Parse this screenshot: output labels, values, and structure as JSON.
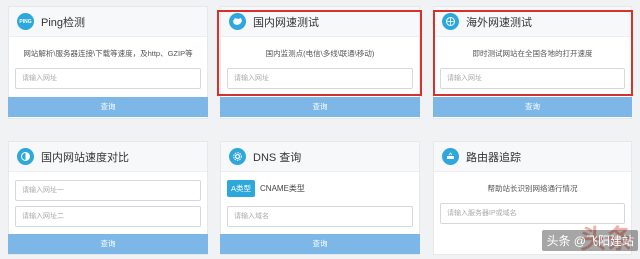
{
  "cards": [
    {
      "title": "Ping检测",
      "icon_label": "PING",
      "icon": "ping-icon",
      "description": "网站解析\\服务器连接\\下载等速度，及http、GZIP等",
      "input_placeholder": "请输入网址",
      "button": "查询"
    },
    {
      "title": "国内网速测试",
      "icon": "china-map-icon",
      "description": "国内监测点(电信\\多线\\联通\\移动)",
      "input_placeholder": "请输入网址",
      "button": "查询"
    },
    {
      "title": "海外网速测试",
      "icon": "globe-icon",
      "description": "即时测试网站在全国各地的打开速度",
      "input_placeholder": "请输入网址",
      "button": "查询"
    },
    {
      "title": "国内网站速度对比",
      "icon": "half-circle-icon",
      "input_placeholder_1": "请输入网址一",
      "input_placeholder_2": "请输入网址二",
      "button": "查询"
    },
    {
      "title": "DNS 查询",
      "icon": "dns-gear-icon",
      "type_tag": "A类型",
      "type_text": "CNAME类型",
      "input_placeholder": "请输入域名",
      "button": "查询"
    },
    {
      "title": "路由器追踪",
      "icon": "router-icon",
      "description": "帮助站长识别网络通行情况",
      "input_placeholder": "请输入服务器IP或域名",
      "button": "查询"
    }
  ],
  "watermark": {
    "logo_text": "头条",
    "caption": "头条 @飞阳建站"
  },
  "colors": {
    "accent": "#2ea8dc",
    "button": "#7db7e8",
    "highlight": "#d6312b"
  }
}
